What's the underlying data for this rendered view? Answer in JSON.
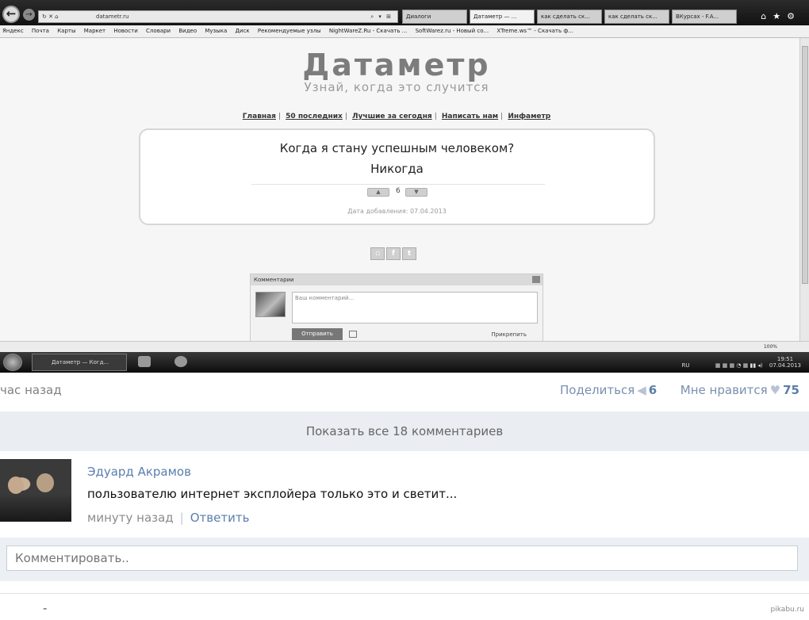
{
  "browser": {
    "address": "datametr.ru",
    "tabs": [
      "Диалоги",
      "Датаметр — ...",
      "как сделать ск...",
      "как сделать ск...",
      "ВКурсах - F.A..."
    ],
    "favorites": [
      "Яндекс",
      "Почта",
      "Карты",
      "Маркет",
      "Новости",
      "Словари",
      "Видео",
      "Музыка",
      "Диск",
      "Рекомендуемые узлы",
      "NightWareZ.Ru - Скачать ...",
      "SoftWarez.ru - Новый со...",
      "XTreme.ws™ - Скачать ф..."
    ],
    "zoom": "100%"
  },
  "site": {
    "logo": "Датаметр",
    "tagline": "Узнай, когда это случится",
    "nav": [
      "Главная",
      "50 последних",
      "Лучшие за сегодня",
      "Написать нам",
      "Инфаметр"
    ],
    "question": "Когда я стану успешным человеком?",
    "answer": "Никогда",
    "vote_count": "6",
    "date": "Дата добавления: 07.04.2013",
    "comments_title": "Комментарии",
    "comment_placeholder": "Ваш комментарий...",
    "send_label": "Отправить",
    "attach_label": "Прикрепить"
  },
  "taskbar": {
    "window_title": "Датаметр — Когд...",
    "lang": "RU",
    "time": "19:51",
    "date": "07.04.2013"
  },
  "post": {
    "time_ago": "час назад",
    "share_label": "Поделиться",
    "share_count": "6",
    "like_label": "Мне нравится",
    "like_count": "75",
    "show_all": "Показать все 18 комментариев"
  },
  "comment": {
    "author": "Эдуард Акрамов",
    "text": "пользователю интернет эксплойера только это и светит...",
    "time": "минуту назад",
    "reply": "Ответить"
  },
  "composer": {
    "placeholder": "Комментировать.."
  },
  "footer": {
    "dash": "-",
    "watermark": "pikabu.ru"
  }
}
